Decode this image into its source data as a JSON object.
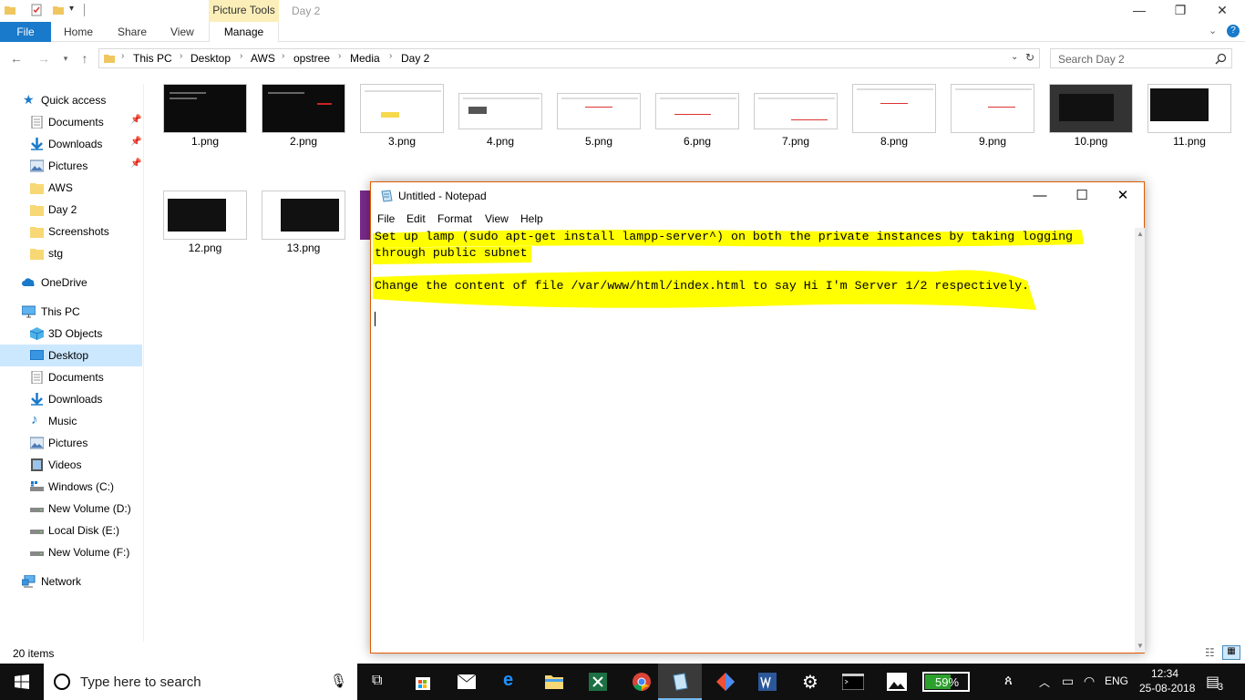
{
  "explorer": {
    "window_title": "Day 2",
    "context_tab_label": "Picture Tools",
    "ribbon_tabs": [
      "File",
      "Home",
      "Share",
      "View",
      "Manage"
    ],
    "breadcrumb": [
      "This PC",
      "Desktop",
      "AWS",
      "opstree",
      "Media",
      "Day 2"
    ],
    "search_placeholder": "Search Day 2",
    "nav": {
      "quick_access": "Quick access",
      "quick_items": [
        "Documents",
        "Downloads",
        "Pictures",
        "AWS",
        "Day 2",
        "Screenshots",
        "stg"
      ],
      "onedrive": "OneDrive",
      "this_pc": "This PC",
      "pc_items": [
        "3D Objects",
        "Desktop",
        "Documents",
        "Downloads",
        "Music",
        "Pictures",
        "Videos",
        "Windows (C:)",
        "New Volume (D:)",
        "Local Disk (E:)",
        "New Volume (F:)"
      ],
      "network": "Network"
    },
    "files": [
      "1.png",
      "2.png",
      "3.png",
      "4.png",
      "5.png",
      "6.png",
      "7.png",
      "8.png",
      "9.png",
      "10.png",
      "11.png",
      "12.png",
      "13.png"
    ],
    "status_items": "20 items"
  },
  "notepad": {
    "title": "Untitled - Notepad",
    "menu": [
      "File",
      "Edit",
      "Format",
      "View",
      "Help"
    ],
    "lines": [
      "Set up lamp (sudo apt-get install lampp-server^) on both the private instances by taking logging",
      "through public subnet",
      "",
      "Change the content of file /var/www/html/index.html to say Hi I'm Server 1/2 respectively."
    ],
    "highlight_color": "#ffff00"
  },
  "taskbar": {
    "search_placeholder": "Type here to search",
    "battery": "59%",
    "language": "ENG",
    "time": "12:34",
    "date": "25-08-2018",
    "notifications": "3"
  },
  "colors": {
    "accent": "#1979ca",
    "nav_selected": "#cce8ff",
    "context_tab": "#fbeeb8",
    "notepad_border": "#e05a00"
  }
}
